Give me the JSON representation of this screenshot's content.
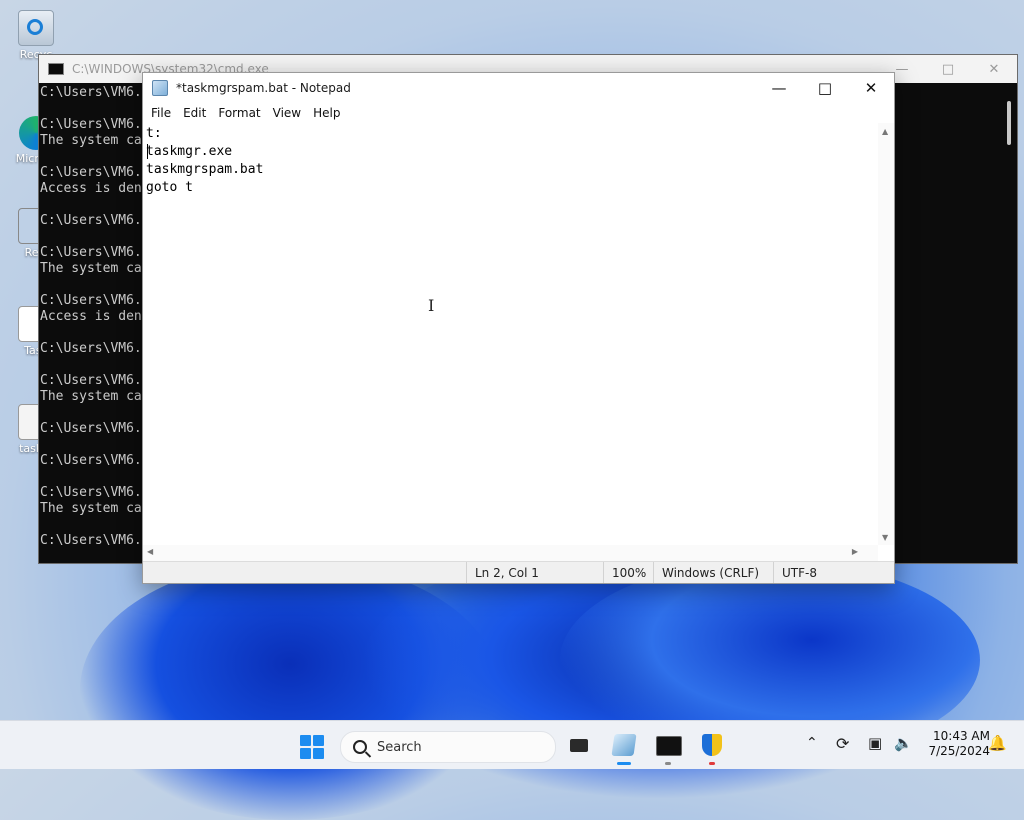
{
  "desktop": {
    "icons": [
      {
        "label": "Recycle Bin",
        "shown": "Recyc"
      },
      {
        "label": "Microsoft Edge",
        "shown": "Micr Ed"
      },
      {
        "label": "Retro",
        "shown": "Retr"
      },
      {
        "label": "Task",
        "shown": "Task"
      },
      {
        "label": "taskmgr",
        "shown": "taskm"
      }
    ]
  },
  "cmd": {
    "title": "C:\\WINDOWS\\system32\\cmd.exe",
    "lines": "C:\\Users\\VM6.\n\nC:\\Users\\VM6.\nThe system ca\n\nC:\\Users\\VM6.\nAccess is den\n\nC:\\Users\\VM6.\n\nC:\\Users\\VM6.\nThe system ca\n\nC:\\Users\\VM6.\nAccess is den\n\nC:\\Users\\VM6.\n\nC:\\Users\\VM6.\nThe system ca\n\nC:\\Users\\VM6.\n\nC:\\Users\\VM6.\n\nC:\\Users\\VM6.\nThe system ca\n\nC:\\Users\\VM6."
  },
  "notepad": {
    "title": "*taskmgrspam.bat - Notepad",
    "menu": [
      "File",
      "Edit",
      "Format",
      "View",
      "Help"
    ],
    "content": "t:\ntaskmgr.exe\ntaskmgrspam.bat\ngoto t",
    "status": {
      "position": "Ln 2, Col 1",
      "zoom": "100%",
      "line_ending": "Windows (CRLF)",
      "encoding": "UTF-8"
    }
  },
  "taskbar": {
    "search_placeholder": "Search",
    "time": "10:43 AM",
    "date": "7/25/2024"
  },
  "colors": {
    "accent": "#1c8cf0",
    "cmd_bg": "#0c0c0c",
    "taskbar_bg": "#eef1f6"
  }
}
